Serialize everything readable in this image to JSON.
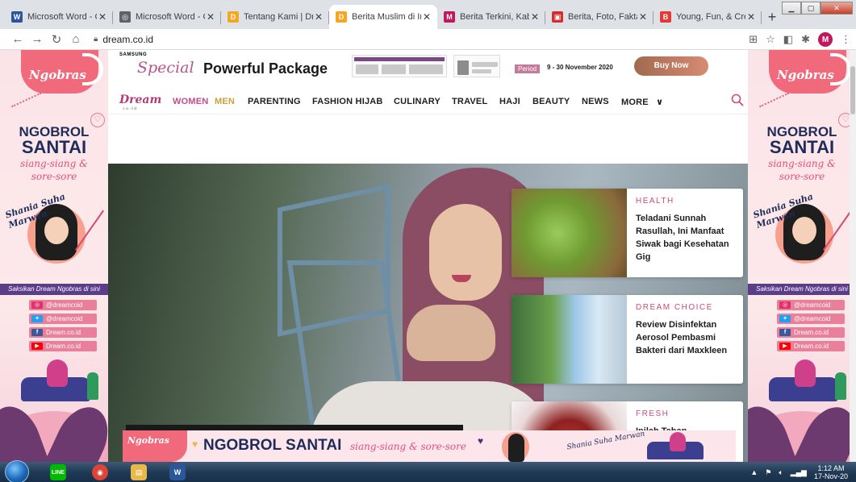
{
  "browser": {
    "tabs": [
      {
        "title": "Microsoft Word - C",
        "icon": "word-doc-icon",
        "color": "#2b579a",
        "glyph": "W"
      },
      {
        "title": "Microsoft Word - C",
        "icon": "globe-icon",
        "color": "#5f6368",
        "glyph": "◎"
      },
      {
        "title": "Tentang Kami | Dre",
        "icon": "dream-favicon-icon",
        "color": "#f5a623",
        "glyph": "D"
      },
      {
        "title": "Berita Muslim di In",
        "icon": "dream-favicon-icon",
        "color": "#f5a623",
        "glyph": "D",
        "active": true
      },
      {
        "title": "Berita Terkini, Kaba",
        "icon": "kapanlagi-favicon-icon",
        "color": "#c2185b",
        "glyph": "M"
      },
      {
        "title": "Berita, Foto, Fakta",
        "icon": "news-favicon-icon",
        "color": "#d32f2f",
        "glyph": "▣"
      },
      {
        "title": "Young, Fun, & Crea",
        "icon": "b-favicon-icon",
        "color": "#e53935",
        "glyph": "B"
      }
    ],
    "new_tab": "+",
    "url": "dream.co.id",
    "profile_initial": "M"
  },
  "ad": {
    "brand": "SAMSUNG",
    "special": "Special",
    "powerful": "Powerful Package",
    "period_label": "Period",
    "period_value": "9 - 30 November 2020",
    "buy_now": "Buy Now"
  },
  "nav": {
    "logo": "Dream",
    "logo_sub": "co.id",
    "women": "WOMEN",
    "men": "MEN",
    "items": [
      "PARENTING",
      "FASHION HIJAB",
      "CULINARY",
      "TRAVEL",
      "HAJI",
      "BEAUTY",
      "NEWS",
      "MORE"
    ],
    "more_caret": "∨"
  },
  "side_banner": {
    "logo": "Ngobras",
    "title1": "NGOBROL",
    "title2": "SANTAI",
    "script1": "siang-siang &",
    "script2": "sore-sore",
    "host": "Shania Suha Marwan",
    "strip": "Saksikan Dream Ngobras di sini",
    "socials": [
      {
        "icon": "instagram-icon",
        "label": "@dreamcoid",
        "color": "#e1306c",
        "glyph": "◎"
      },
      {
        "icon": "twitter-icon",
        "label": "@dreamcoid",
        "color": "#1da1f2",
        "glyph": "✦"
      },
      {
        "icon": "facebook-icon",
        "label": "Dream.co.id",
        "color": "#3b5998",
        "glyph": "f"
      },
      {
        "icon": "youtube-icon",
        "label": "Dream.co.id",
        "color": "#ff0000",
        "glyph": "▶"
      }
    ]
  },
  "cards": [
    {
      "category": "HEALTH",
      "title": "Teladani Sunnah Rasullah, Ini Manfaat Siwak bagi Kesehatan Gig"
    },
    {
      "category": "DREAM CHOICE",
      "title": "Review Disinfektan Aerosol Pembasmi Bakteri dari Maxkleen"
    },
    {
      "category": "FRESH",
      "title": "Inilah Tahap"
    }
  ],
  "bottom_banner": {
    "logo": "Ngobras",
    "title": "NGOBROL SANTAI",
    "script": "siang-siang & sore-sore",
    "host": "Shania Suha Marwan"
  },
  "taskbar": {
    "apps": [
      {
        "name": "line-app",
        "label": "LINE",
        "color": "#00b900"
      },
      {
        "name": "chrome-app",
        "label": "◉",
        "color": "#db4437"
      },
      {
        "name": "explorer-app",
        "label": "▤",
        "color": "#e8b84b"
      },
      {
        "name": "word-app",
        "label": "W",
        "color": "#2b579a"
      }
    ],
    "time": "1:12 AM",
    "date": "17-Nov-20"
  }
}
